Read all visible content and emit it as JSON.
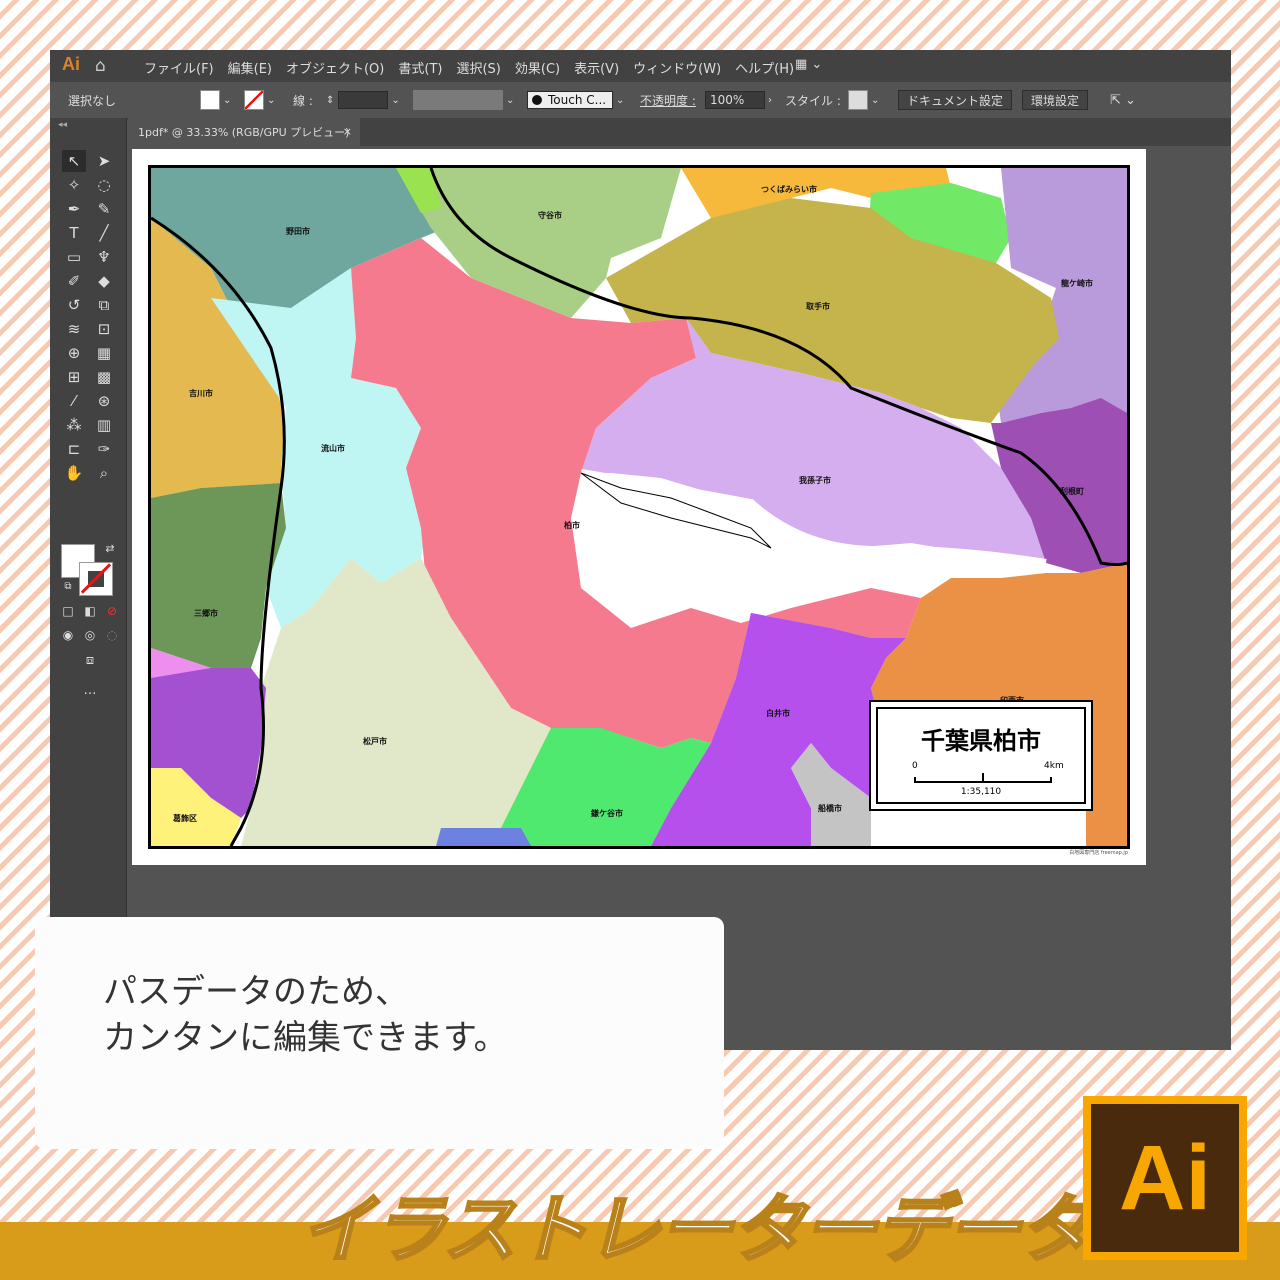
{
  "app": {
    "logo": "Ai",
    "menus": [
      "ファイル(F)",
      "編集(E)",
      "オブジェクト(O)",
      "書式(T)",
      "選択(S)",
      "効果(C)",
      "表示(V)",
      "ウィンドウ(W)",
      "ヘルプ(H)"
    ]
  },
  "control": {
    "selection": "選択なし",
    "stroke_label": "線 :",
    "brush": "Touch C...",
    "opacity_label": "不透明度 :",
    "opacity": "100%",
    "style_label": "スタイル :",
    "doc_settings": "ドキュメント設定",
    "prefs": "環境設定"
  },
  "tab": {
    "title": "1pdf* @ 33.33% (RGB/GPU プレビュー)",
    "close": "×"
  },
  "map": {
    "labels": [
      "野田市",
      "守谷市",
      "つくばみらい市",
      "龍ケ崎市",
      "取手市",
      "吉川市",
      "流山市",
      "柏市",
      "我孫子市",
      "利根町",
      "三郷市",
      "印西市",
      "白井市",
      "松戸市",
      "葛飾区",
      "鎌ケ谷市",
      "船橋市"
    ],
    "legend_title": "千葉県柏市",
    "scale_start": "0",
    "scale_end": "4km",
    "scale_ratio": "1:35,110",
    "credit": "白地図専門店 freemap.jp"
  },
  "callout": {
    "line1": "パスデータのため、",
    "line2": "カンタンに編集できます。"
  },
  "banner": {
    "title": "イラストレーターデータ",
    "badge": "Ai"
  }
}
